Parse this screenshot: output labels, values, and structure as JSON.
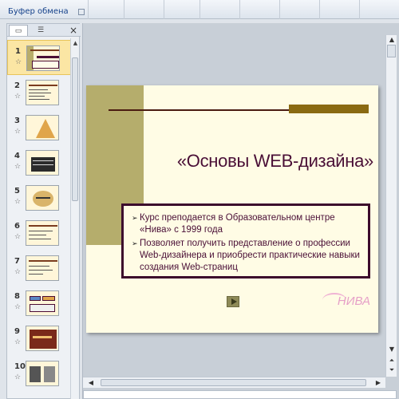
{
  "ribbon": {
    "group_label": "Буфер обмена"
  },
  "slides_panel": {
    "tabs": [
      "slides-tab",
      "outline-tab"
    ],
    "close_label": "×",
    "slides": [
      {
        "number": "1",
        "selected": true
      },
      {
        "number": "2"
      },
      {
        "number": "3"
      },
      {
        "number": "4"
      },
      {
        "number": "5"
      },
      {
        "number": "6"
      },
      {
        "number": "7"
      },
      {
        "number": "8"
      },
      {
        "number": "9"
      },
      {
        "number": "10"
      }
    ]
  },
  "slide": {
    "title": "«Основы WEB-дизайна»",
    "bullets": [
      "Курс преподается в Образовательном центре «Нива» с 1999 года",
      "Позволяет получить представление о профессии Web-дизайнера и приобрести практические навыки создания Web-страниц"
    ],
    "bullet_marker": "➢",
    "logo_text": "НИВА"
  },
  "colors": {
    "slide_background": "#fffce5",
    "accent_olive": "#b5ad6c",
    "title_color": "#4a0f36",
    "accent_bar": "#8a6a12"
  }
}
